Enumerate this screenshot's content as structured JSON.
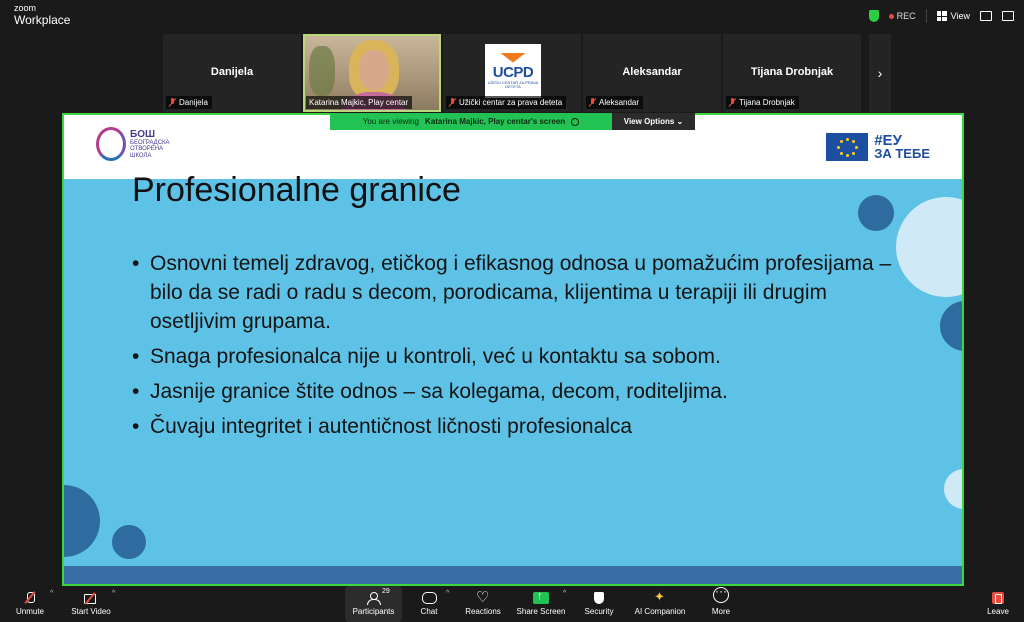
{
  "app": {
    "brand_line1": "zoom",
    "brand_line2": "Workplace"
  },
  "topbar": {
    "recording": "REC",
    "view_label": "View"
  },
  "participants": [
    {
      "name": "Danijela",
      "big_label": "Danijela",
      "muted": true
    },
    {
      "name": "Katarina Majkic, Play centar",
      "big_label": "",
      "muted": false,
      "active": true
    },
    {
      "name": "Užički centar za prava deteta",
      "big_label": "",
      "muted": true,
      "logo_text": "UCPD",
      "logo_sub": "UŽIČKI CENTAR ZA PRAVA DETETA"
    },
    {
      "name": "Aleksandar",
      "big_label": "Aleksandar",
      "muted": true
    },
    {
      "name": "Tijana Drobnjak",
      "big_label": "Tijana Drobnjak",
      "muted": true
    }
  ],
  "banner": {
    "prefix": "You are viewing",
    "owner": "Katarina Majkic, Play centar's screen",
    "view_options": "View Options"
  },
  "slide": {
    "logo_left_title": "БОШ",
    "logo_left_sub": "БЕОГРАДСКА ОТВОРЕНА ШКОЛА",
    "logo_right_line1": "#ЕУ",
    "logo_right_line2": "ЗА ТЕБЕ",
    "title": "Profesionalne granice",
    "bullets": [
      "Osnovni temelj zdravog, etičkog i efikasnog odnosa u pomažućim profesijama – bilo da se radi o radu s decom, porodicama, klijentima u terapiji ili drugim osetljivim grupama.",
      "Snaga profesionalca  nije u kontroli, već u kontaktu sa sobom.",
      "Jasnije granice štite odnos – sa kolegama, decom, roditeljima.",
      "Čuvaju integritet i autentičnost ličnosti profesionalca"
    ],
    "colors": {
      "background": "#5ec2e6",
      "circle_dark": "#2e6b9e",
      "circle_light": "#cfeaf6"
    }
  },
  "toolbar": {
    "unmute": "Unmute",
    "start_video": "Start Video",
    "participants": "Participants",
    "participants_count": "29",
    "chat": "Chat",
    "reactions": "Reactions",
    "share_screen": "Share Screen",
    "security": "Security",
    "ai_companion": "AI Companion",
    "more": "More",
    "leave": "Leave"
  }
}
